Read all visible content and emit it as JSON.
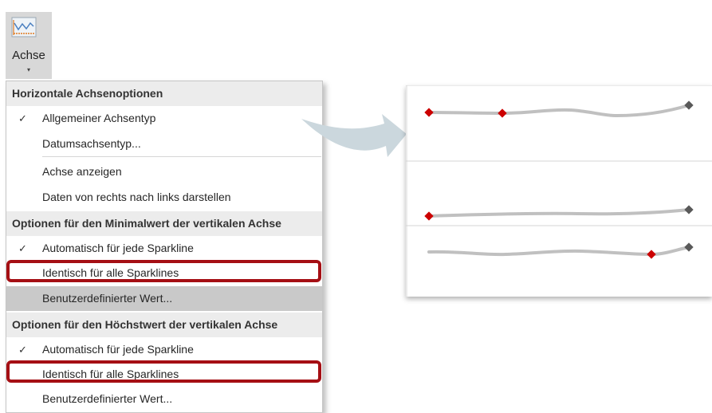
{
  "ribbon": {
    "axis_button": {
      "label": "Achse",
      "icon": "sparkline-axis-icon",
      "caret": "▾"
    }
  },
  "menu": {
    "sections": [
      {
        "header": "Horizontale Achsenoptionen",
        "items": [
          {
            "label": "Allgemeiner Achsentyp",
            "checked": true
          },
          {
            "label": "Datumsachsentyp...",
            "checked": false
          },
          {
            "label": "Achse anzeigen",
            "checked": false
          },
          {
            "label": "Daten von rechts nach links darstellen",
            "checked": false
          }
        ]
      },
      {
        "header": "Optionen für den Minimalwert der vertikalen Achse",
        "items": [
          {
            "label": "Automatisch für jede Sparkline",
            "checked": true
          },
          {
            "label": "Identisch für alle Sparklines",
            "checked": false,
            "highlighted": true
          },
          {
            "label": "Benutzerdefinierter Wert...",
            "checked": false,
            "selected": true
          }
        ]
      },
      {
        "header": "Optionen für den Höchstwert der vertikalen Achse",
        "items": [
          {
            "label": "Automatisch für jede Sparkline",
            "checked": true
          },
          {
            "label": "Identisch für alle Sparklines",
            "checked": false,
            "highlighted": true
          },
          {
            "label": "Benutzerdefinierter Wert...",
            "checked": false
          }
        ]
      }
    ],
    "check_glyph": "✓",
    "highlight_color": "#a50f14"
  },
  "arrow": {
    "color": "#cbd7dd",
    "icon": "right-arrow-icon"
  },
  "sparklines": {
    "line_color": "#c0c0c0",
    "marker_color": "#cc0000",
    "last_marker_color": "#595959"
  }
}
